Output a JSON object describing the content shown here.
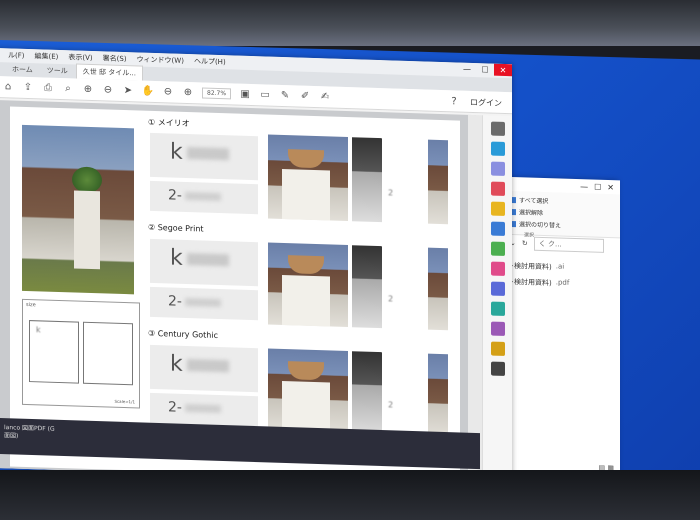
{
  "menubar": {
    "items": [
      "ル(F)",
      "編集(E)",
      "表示(V)",
      "署名(S)",
      "ウィンドウ(W)",
      "ヘルプ(H)"
    ]
  },
  "tabs": [
    {
      "label": "ホーム"
    },
    {
      "label": "ツール"
    },
    {
      "label": "久世 邸 タイル..."
    }
  ],
  "toolbar": {
    "zoom": "82.7%",
    "login": "ログイン",
    "help": "?"
  },
  "page": {
    "size_label": "size",
    "size_blur_1": "k",
    "size_blur_2": "",
    "scale_label": "Scale=1/1",
    "sections": [
      {
        "title": "① メイリオ",
        "name": "k",
        "number": "2-"
      },
      {
        "title": "② Segoe Print",
        "name": "k",
        "number": "2-"
      },
      {
        "title": "③ Century Gothic",
        "name": "k",
        "number": "2-"
      }
    ],
    "side_marks": [
      "2",
      "2",
      "2"
    ]
  },
  "explorer": {
    "ribbon_items": [
      "すべて選択",
      "選択解除",
      "選択の切り替え"
    ],
    "ribbon_group": "選択",
    "search_placeholder": "く ク...",
    "files": [
      {
        "name": "ント検討用資料)",
        "ext": ".ai"
      },
      {
        "name": "ント検討用資料)",
        "ext": ".pdf"
      }
    ]
  },
  "taskbar": {
    "text_1": "lanco 図面PDF (G",
    "text_2": "面図)"
  },
  "colors": {
    "desktop": "#1450c8",
    "close_button": "#e81123",
    "taskbar": "#2c2d3a"
  }
}
